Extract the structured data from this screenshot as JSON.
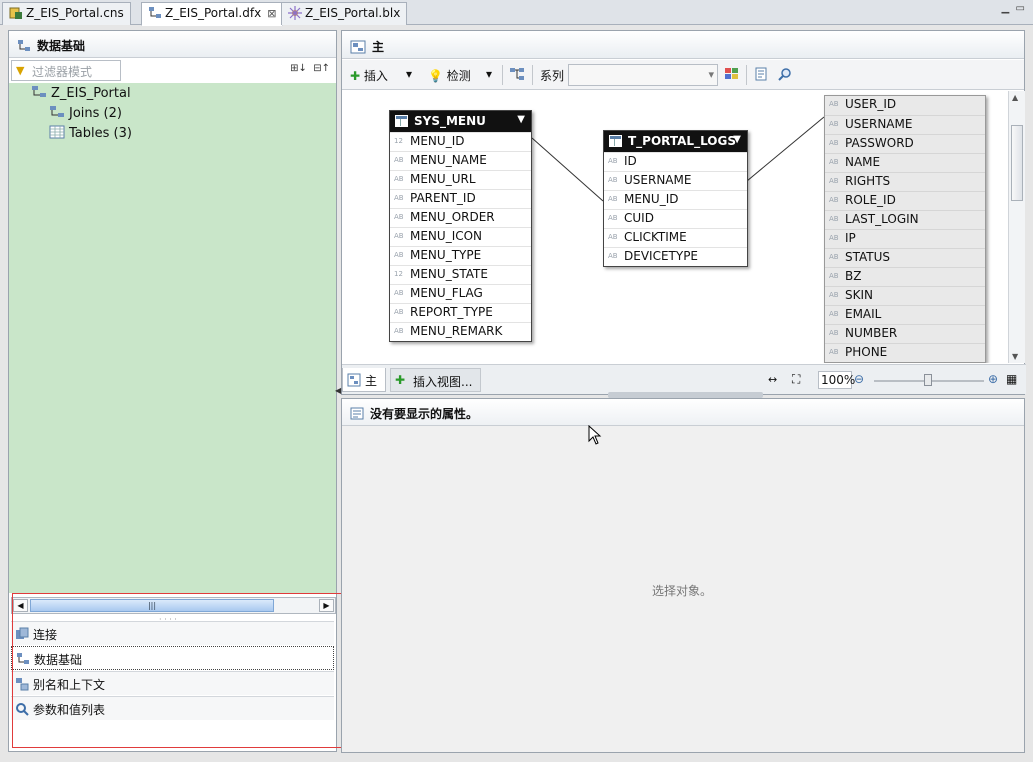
{
  "editor_tabs": [
    {
      "label": "Z_EIS_Portal.cns",
      "icon": "connection-icon",
      "active": false
    },
    {
      "label": "Z_EIS_Portal.dfx",
      "icon": "data-foundation-icon",
      "active": true,
      "close": "⊠"
    },
    {
      "label": "Z_EIS_Portal.blx",
      "icon": "business-layer-icon",
      "active": false
    }
  ],
  "left_panel": {
    "title": "数据基础",
    "filter_placeholder": "过滤器模式",
    "tree": {
      "root": "Z_EIS_Portal",
      "joins": "Joins (2)",
      "tables": "Tables (3)"
    },
    "nav": [
      "连接",
      "数据基础",
      "别名和上下文",
      "参数和值列表"
    ]
  },
  "main_panel": {
    "title": "主",
    "toolbar": {
      "insert": "插入",
      "detect": "检测",
      "family": "系列",
      "family_value": ""
    },
    "tables": [
      {
        "name": "SYS_MENU",
        "cols": [
          {
            "t": "12",
            "n": "MENU_ID"
          },
          {
            "t": "AB",
            "n": "MENU_NAME"
          },
          {
            "t": "AB",
            "n": "MENU_URL"
          },
          {
            "t": "AB",
            "n": "PARENT_ID"
          },
          {
            "t": "AB",
            "n": "MENU_ORDER"
          },
          {
            "t": "AB",
            "n": "MENU_ICON"
          },
          {
            "t": "AB",
            "n": "MENU_TYPE"
          },
          {
            "t": "12",
            "n": "MENU_STATE"
          },
          {
            "t": "AB",
            "n": "MENU_FLAG"
          },
          {
            "t": "AB",
            "n": "REPORT_TYPE"
          },
          {
            "t": "AB",
            "n": "MENU_REMARK"
          }
        ]
      },
      {
        "name": "T_PORTAL_LOGS",
        "cols": [
          {
            "t": "AB",
            "n": "ID"
          },
          {
            "t": "AB",
            "n": "USERNAME"
          },
          {
            "t": "AB",
            "n": "MENU_ID"
          },
          {
            "t": "AB",
            "n": "CUID"
          },
          {
            "t": "AB",
            "n": "CLICKTIME"
          },
          {
            "t": "AB",
            "n": "DEVICETYPE"
          }
        ]
      },
      {
        "name": "",
        "cols": [
          {
            "t": "AB",
            "n": "USER_ID"
          },
          {
            "t": "AB",
            "n": "USERNAME"
          },
          {
            "t": "AB",
            "n": "PASSWORD"
          },
          {
            "t": "AB",
            "n": "NAME"
          },
          {
            "t": "AB",
            "n": "RIGHTS"
          },
          {
            "t": "AB",
            "n": "ROLE_ID"
          },
          {
            "t": "AB",
            "n": "LAST_LOGIN"
          },
          {
            "t": "AB",
            "n": "IP"
          },
          {
            "t": "AB",
            "n": "STATUS"
          },
          {
            "t": "AB",
            "n": "BZ"
          },
          {
            "t": "AB",
            "n": "SKIN"
          },
          {
            "t": "AB",
            "n": "EMAIL"
          },
          {
            "t": "AB",
            "n": "NUMBER"
          },
          {
            "t": "AB",
            "n": "PHONE"
          }
        ]
      }
    ],
    "bottom_tabs": {
      "main": "主",
      "insert_view": "插入视图..."
    },
    "zoom": "100%"
  },
  "properties": {
    "title": "没有要显示的属性。",
    "message": "选择对象。"
  },
  "colors": {
    "tree_bg": "#c9e6c9",
    "highlight_box": "#e03b3b",
    "table_header": "#111111"
  }
}
